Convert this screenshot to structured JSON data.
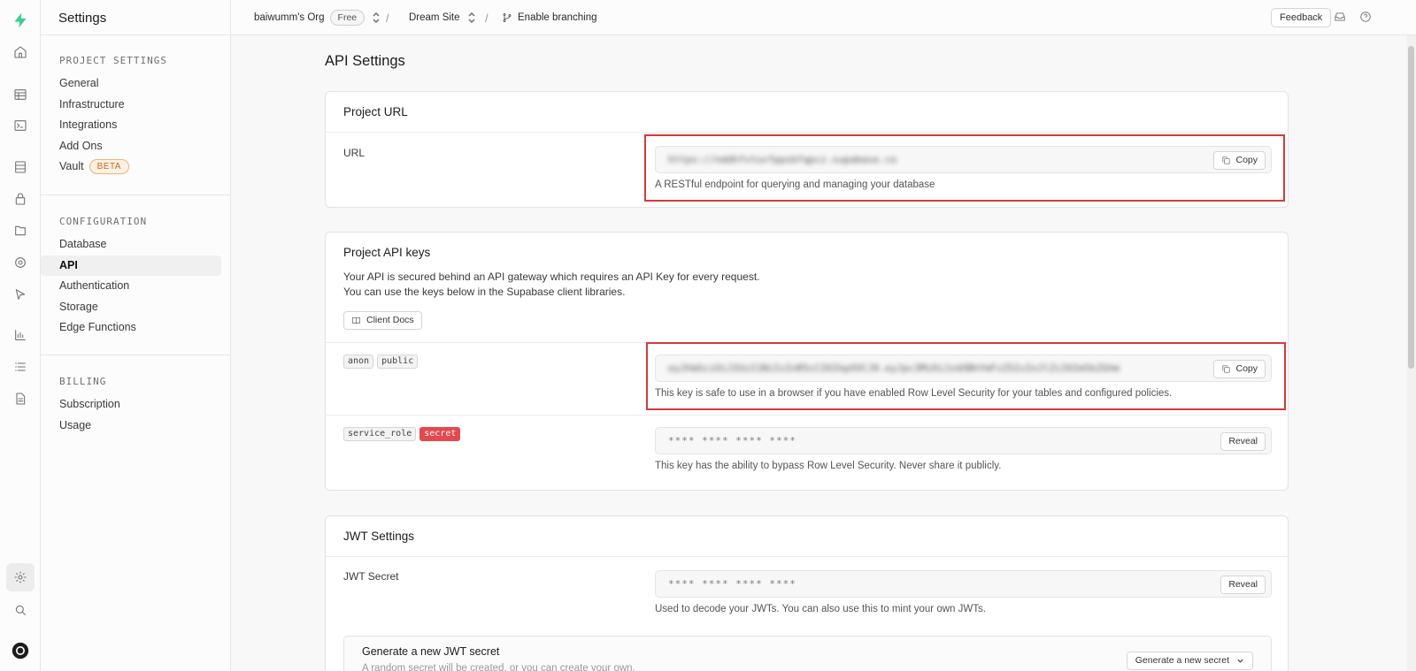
{
  "app": {
    "title": "Settings"
  },
  "menu": {
    "sections": [
      {
        "title": "PROJECT SETTINGS",
        "items": [
          {
            "label": "General"
          },
          {
            "label": "Infrastructure"
          },
          {
            "label": "Integrations"
          },
          {
            "label": "Add Ons"
          },
          {
            "label": "Vault",
            "badge": "BETA"
          }
        ]
      },
      {
        "title": "CONFIGURATION",
        "items": [
          {
            "label": "Database"
          },
          {
            "label": "API",
            "active": true
          },
          {
            "label": "Authentication"
          },
          {
            "label": "Storage"
          },
          {
            "label": "Edge Functions"
          }
        ]
      },
      {
        "title": "BILLING",
        "items": [
          {
            "label": "Subscription"
          },
          {
            "label": "Usage"
          }
        ]
      }
    ]
  },
  "topbar": {
    "org": "baiwumm's Org",
    "plan": "Free",
    "project": "Dream Site",
    "branching": "Enable branching",
    "feedback": "Feedback"
  },
  "page": {
    "title": "API Settings"
  },
  "project_url": {
    "heading": "Project URL",
    "label": "URL",
    "value": "https://nddhfvtuvfppsbfqpcz.supabase.co",
    "copy": "Copy",
    "help": "A RESTful endpoint for querying and managing your database"
  },
  "api_keys": {
    "heading": "Project API keys",
    "desc_line1": "Your API is secured behind an API gateway which requires an API Key for every request.",
    "desc_line2": "You can use the keys below in the Supabase client libraries.",
    "docs_button": "Client Docs",
    "anon": {
      "tag1": "anon",
      "tag2": "public",
      "value": "eyJhbGciOiJIUzI1NiIsInR5cCI6IkpXVCJ9.eyJpc3MiOiJzdXBhYmFzZSIsInJlZiI6Im5kZGhm",
      "copy": "Copy",
      "help": "This key is safe to use in a browser if you have enabled Row Level Security for your tables and configured policies."
    },
    "service": {
      "tag1": "service_role",
      "tag2": "secret",
      "value": "**** **** **** ****",
      "reveal": "Reveal",
      "help": "This key has the ability to bypass Row Level Security. Never share it publicly."
    }
  },
  "jwt": {
    "heading": "JWT Settings",
    "label": "JWT Secret",
    "value": "**** **** **** ****",
    "reveal": "Reveal",
    "help": "Used to decode your JWTs. You can also use this to mint your own JWTs.",
    "gen_title": "Generate a new JWT secret",
    "gen_desc": "A random secret will be created, or you can create your own.",
    "gen_button": "Generate a new secret"
  },
  "colors": {
    "brand": "#3ecf8e",
    "highlight": "#d33b3b",
    "secret": "#e5484d"
  }
}
